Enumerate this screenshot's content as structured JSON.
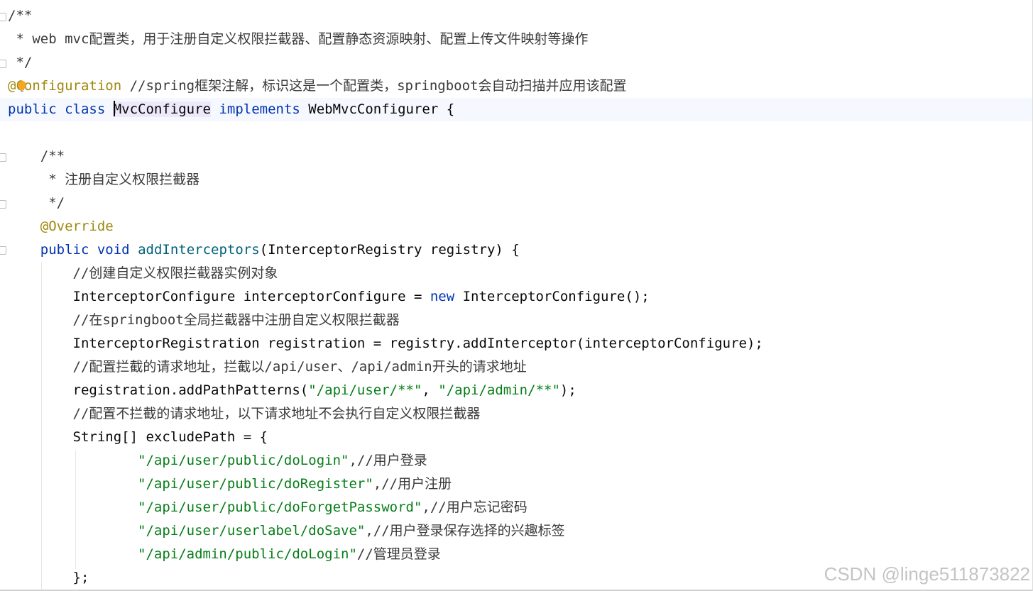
{
  "editor": {
    "language": "java",
    "colors": {
      "keyword": "#0033b3",
      "string": "#067d17",
      "annotation": "#9e880d",
      "comment": "#3a3a3a",
      "plain": "#080808",
      "current_line": "#f5f8fe",
      "identifier_highlight": "#ede9fb"
    },
    "lines": [
      {
        "tokens": [
          {
            "t": "/**",
            "k": "comment"
          }
        ]
      },
      {
        "tokens": [
          {
            "t": " * web mvc配置类，用于注册自定义权限拦截器、配置静态资源映射、配置上传文件映射等操作",
            "k": "comment"
          }
        ]
      },
      {
        "tokens": [
          {
            "t": " */",
            "k": "comment"
          }
        ]
      },
      {
        "tokens": [
          {
            "t": "@Configuration",
            "k": "ann"
          },
          {
            "t": " //spring框架注解，标识这是一个配置类，springboot会自动扫描并应用该配置",
            "k": "comment"
          }
        ]
      },
      {
        "tokens": [
          {
            "t": "public class ",
            "k": "kw"
          },
          {
            "t": "MvcConfigure",
            "k": "hl"
          },
          {
            "t": " ",
            "k": "plain"
          },
          {
            "t": "implements",
            "k": "kw"
          },
          {
            "t": " WebMvcConfigurer {",
            "k": "plain"
          }
        ]
      },
      {
        "tokens": []
      },
      {
        "tokens": [
          {
            "t": "    /**",
            "k": "comment"
          }
        ]
      },
      {
        "tokens": [
          {
            "t": "     * 注册自定义权限拦截器",
            "k": "comment"
          }
        ]
      },
      {
        "tokens": [
          {
            "t": "     */",
            "k": "comment"
          }
        ]
      },
      {
        "tokens": [
          {
            "t": "    @Override",
            "k": "ann"
          }
        ]
      },
      {
        "tokens": [
          {
            "t": "    ",
            "k": "plain"
          },
          {
            "t": "public void",
            "k": "kw"
          },
          {
            "t": " ",
            "k": "plain"
          },
          {
            "t": "addInterceptors",
            "k": "method"
          },
          {
            "t": "(InterceptorRegistry registry) {",
            "k": "plain"
          }
        ]
      },
      {
        "tokens": [
          {
            "t": "        //创建自定义权限拦截器实例对象",
            "k": "comment"
          }
        ]
      },
      {
        "tokens": [
          {
            "t": "        InterceptorConfigure interceptorConfigure = ",
            "k": "plain"
          },
          {
            "t": "new",
            "k": "kw"
          },
          {
            "t": " InterceptorConfigure();",
            "k": "plain"
          }
        ]
      },
      {
        "tokens": [
          {
            "t": "        //在springboot全局拦截器中注册自定义权限拦截器",
            "k": "comment"
          }
        ]
      },
      {
        "tokens": [
          {
            "t": "        InterceptorRegistration registration = registry.addInterceptor(interceptorConfigure);",
            "k": "plain"
          }
        ]
      },
      {
        "tokens": [
          {
            "t": "        //配置拦截的请求地址，拦截以/api/user、/api/admin开头的请求地址",
            "k": "comment"
          }
        ]
      },
      {
        "tokens": [
          {
            "t": "        registration.addPathPatterns(",
            "k": "plain"
          },
          {
            "t": "\"/api/user/**\"",
            "k": "str"
          },
          {
            "t": ", ",
            "k": "plain"
          },
          {
            "t": "\"/api/admin/**\"",
            "k": "str"
          },
          {
            "t": ");",
            "k": "plain"
          }
        ]
      },
      {
        "tokens": [
          {
            "t": "        //配置不拦截的请求地址，以下请求地址不会执行自定义权限拦截器",
            "k": "comment"
          }
        ]
      },
      {
        "tokens": [
          {
            "t": "        String[] excludePath = {",
            "k": "plain"
          }
        ]
      },
      {
        "tokens": [
          {
            "t": "                ",
            "k": "plain"
          },
          {
            "t": "\"/api/user/public/doLogin\"",
            "k": "str"
          },
          {
            "t": ",//用户登录",
            "k": "comment"
          }
        ]
      },
      {
        "tokens": [
          {
            "t": "                ",
            "k": "plain"
          },
          {
            "t": "\"/api/user/public/doRegister\"",
            "k": "str"
          },
          {
            "t": ",//用户注册",
            "k": "comment"
          }
        ]
      },
      {
        "tokens": [
          {
            "t": "                ",
            "k": "plain"
          },
          {
            "t": "\"/api/user/public/doForgetPassword\"",
            "k": "str"
          },
          {
            "t": ",//用户忘记密码",
            "k": "comment"
          }
        ]
      },
      {
        "tokens": [
          {
            "t": "                ",
            "k": "plain"
          },
          {
            "t": "\"/api/user/userlabel/doSave\"",
            "k": "str"
          },
          {
            "t": ",//用户登录保存选择的兴趣标签",
            "k": "comment"
          }
        ]
      },
      {
        "tokens": [
          {
            "t": "                ",
            "k": "plain"
          },
          {
            "t": "\"/api/admin/public/doLogin\"",
            "k": "str"
          },
          {
            "t": "//管理员登录",
            "k": "comment"
          }
        ]
      },
      {
        "tokens": [
          {
            "t": "        };",
            "k": "plain"
          }
        ]
      }
    ]
  },
  "watermark": "CSDN @linge511873822"
}
